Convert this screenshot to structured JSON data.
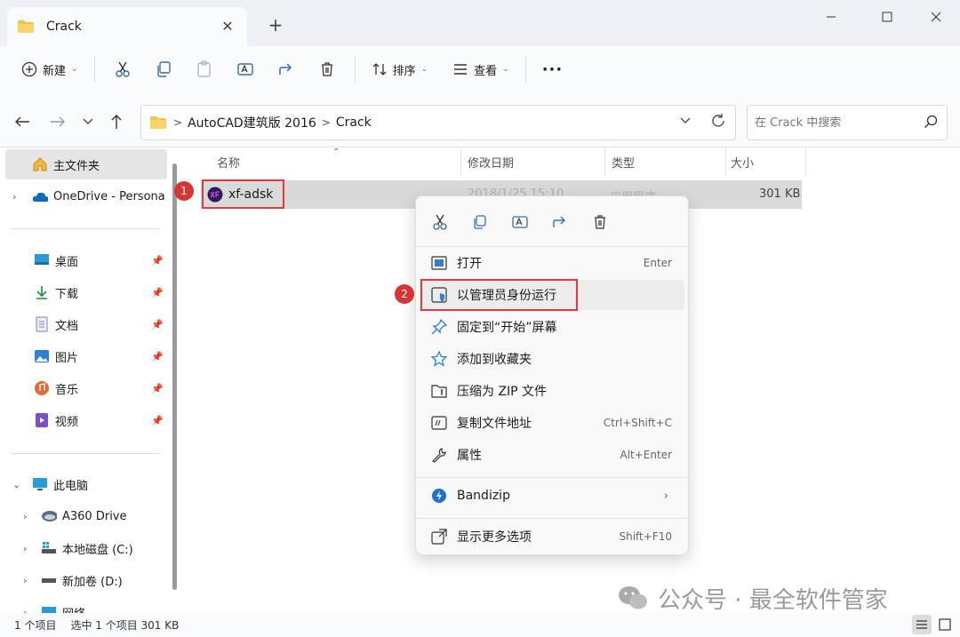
{
  "window": {
    "tab_title": "Crack",
    "tab_close": "✕",
    "new_tab": "+"
  },
  "toolbar": {
    "new_label": "新建",
    "sort_label": "排序",
    "view_label": "查看",
    "more_label": "···"
  },
  "address": {
    "crumbs": [
      "AutoCAD建筑版 2016",
      "Crack"
    ],
    "separator": ">",
    "search_placeholder": "在 Crack 中搜索"
  },
  "sidebar": {
    "home": "主文件夹",
    "onedrive": "OneDrive - Persona",
    "quick": [
      {
        "label": "桌面",
        "icon": "desktop-icon"
      },
      {
        "label": "下载",
        "icon": "download-icon"
      },
      {
        "label": "文档",
        "icon": "document-icon"
      },
      {
        "label": "图片",
        "icon": "pictures-icon"
      },
      {
        "label": "音乐",
        "icon": "music-icon"
      },
      {
        "label": "视频",
        "icon": "video-icon"
      }
    ],
    "pc": "此电脑",
    "drives": [
      {
        "label": "A360 Drive",
        "icon": "cloud-drive-icon"
      },
      {
        "label": "本地磁盘 (C:)",
        "icon": "disk-icon"
      },
      {
        "label": "新加卷 (D:)",
        "icon": "disk-icon"
      }
    ],
    "network": "网络"
  },
  "columns": {
    "name": "名称",
    "modified": "修改日期",
    "type": "类型",
    "size": "大小"
  },
  "file": {
    "name": "xf-adsk",
    "modified": "2018/1/25 15:10",
    "type": "应用程序",
    "size": "301 KB"
  },
  "badges": {
    "one": "1",
    "two": "2"
  },
  "context_menu": {
    "items": [
      {
        "label": "打开",
        "shortcut": "Enter",
        "icon": "open-icon"
      },
      {
        "label": "以管理员身份运行",
        "shortcut": "",
        "icon": "shield-icon"
      },
      {
        "label": "固定到“开始”屏幕",
        "shortcut": "",
        "icon": "pin-icon"
      },
      {
        "label": "添加到收藏夹",
        "shortcut": "",
        "icon": "star-icon"
      },
      {
        "label": "压缩为 ZIP 文件",
        "shortcut": "",
        "icon": "zip-icon"
      },
      {
        "label": "复制文件地址",
        "shortcut": "Ctrl+Shift+C",
        "icon": "copy-path-icon"
      },
      {
        "label": "属性",
        "shortcut": "Alt+Enter",
        "icon": "wrench-icon"
      }
    ],
    "bandizip": "Bandizip",
    "more_options": {
      "label": "显示更多选项",
      "shortcut": "Shift+F10"
    }
  },
  "status": {
    "count": "1 个项目",
    "selected": "选中 1 个项目 301 KB"
  },
  "watermark": "公众号 · 最全软件管家",
  "colors": {
    "accent": "#0067c0",
    "highlight_red": "#e23a3a",
    "folder_yellow": "#f3c447"
  }
}
